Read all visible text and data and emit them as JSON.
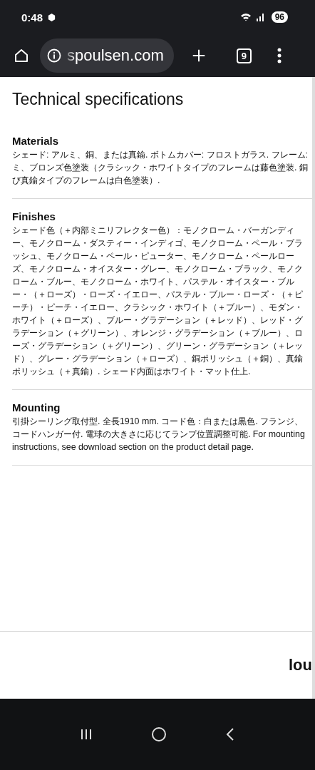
{
  "status_bar": {
    "time": "0:48",
    "battery": "96"
  },
  "browser": {
    "url": "spoulsen.com",
    "tab_count": "9"
  },
  "title": "Technical specifications",
  "sections": [
    {
      "heading": "Materials",
      "kind": "lines",
      "lines": [
        "シェード: アルミ、銅、または真鍮. ボトムカバー: フロストガラス. フレーム:",
        "ミ、ブロンズ色塗装（クラシック・ホワイトタイプのフレームは藤色塗装. 銅",
        "び真鍮タイプのフレームは白色塗装）."
      ]
    },
    {
      "heading": "Finishes",
      "kind": "paragraph",
      "text": "シェード色（＋内部ミニリフレクター色）：モノクローム・バーガンディー、モノクローム・ダスティー・インディゴ、モノクローム・ペール・ブラッシュ、モノクローム・ペール・ピューター、モノクローム・ペールローズ、モノクローム・オイスター・グレー、モノクローム・ブラック、モノクローム・ブルー、モノクローム・ホワイト、パステル・オイスター・ブルー・（＋ローズ）・ローズ・イエロー、パステル・ブルー・ローズ・（＋ピーチ）・ピーチ・イエロー、クラシック・ホワイト（＋ブルー）、モダン・ホワイト（＋ローズ）、ブルー・グラデーション（＋レッド）、レッド・グラデーション（＋グリーン）、オレンジ・グラデーション（＋ブルー）、ローズ・グラデーション（＋グリーン）、グリーン・グラデーション（＋レッド）、グレー・グラデーション（＋ローズ）、銅ポリッシュ（＋銅）、真鍮ポリッシュ（＋真鍮）. シェード内面はホワイト・マット仕上."
    },
    {
      "heading": "Mounting",
      "kind": "paragraph",
      "text": "引掛シーリング取付型.  全長1910 mm. コード色：白または黒色. フランジ、コードハンガー付. 電球の大きさに応じてランプ位置調整可能. For mounting instructions, see download section on the product detail page."
    }
  ],
  "footer": {
    "logo": "lou"
  }
}
